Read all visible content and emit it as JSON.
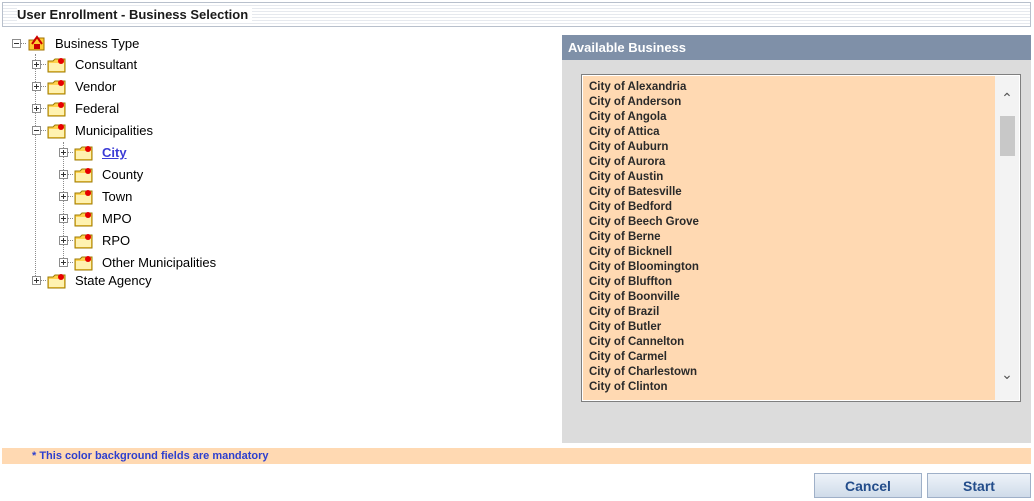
{
  "window": {
    "title": "User Enrollment - Business Selection"
  },
  "tree": {
    "root": "Business Type",
    "consultant": "Consultant",
    "vendor": "Vendor",
    "federal": "Federal",
    "municipalities": "Municipalities",
    "city": "City",
    "county": "County",
    "town": "Town",
    "mpo": "MPO",
    "rpo": "RPO",
    "other": "Other Municipalities",
    "state_agency": "State Agency"
  },
  "available": {
    "header": "Available Business",
    "items": [
      "City of Alexandria",
      "City of Anderson",
      "City of Angola",
      "City of Attica",
      "City of Auburn",
      "City of Aurora",
      "City of Austin",
      "City of Batesville",
      "City of Bedford",
      "City of Beech Grove",
      "City of Berne",
      "City of Bicknell",
      "City of Bloomington",
      "City of Bluffton",
      "City of Boonville",
      "City of Brazil",
      "City of Butler",
      "City of Cannelton",
      "City of Carmel",
      "City of Charlestown",
      "City of Clinton"
    ]
  },
  "footer": {
    "mandatory_note": "* This color background fields are mandatory",
    "cancel": "Cancel",
    "start": "Start"
  },
  "colors": {
    "mandatory_bg": "#ffd9b2",
    "header_bg": "#7f90a8",
    "link": "#3b3bd6"
  },
  "icons": {
    "folder": "folder-star-icon",
    "root": "root-folder-icon"
  }
}
